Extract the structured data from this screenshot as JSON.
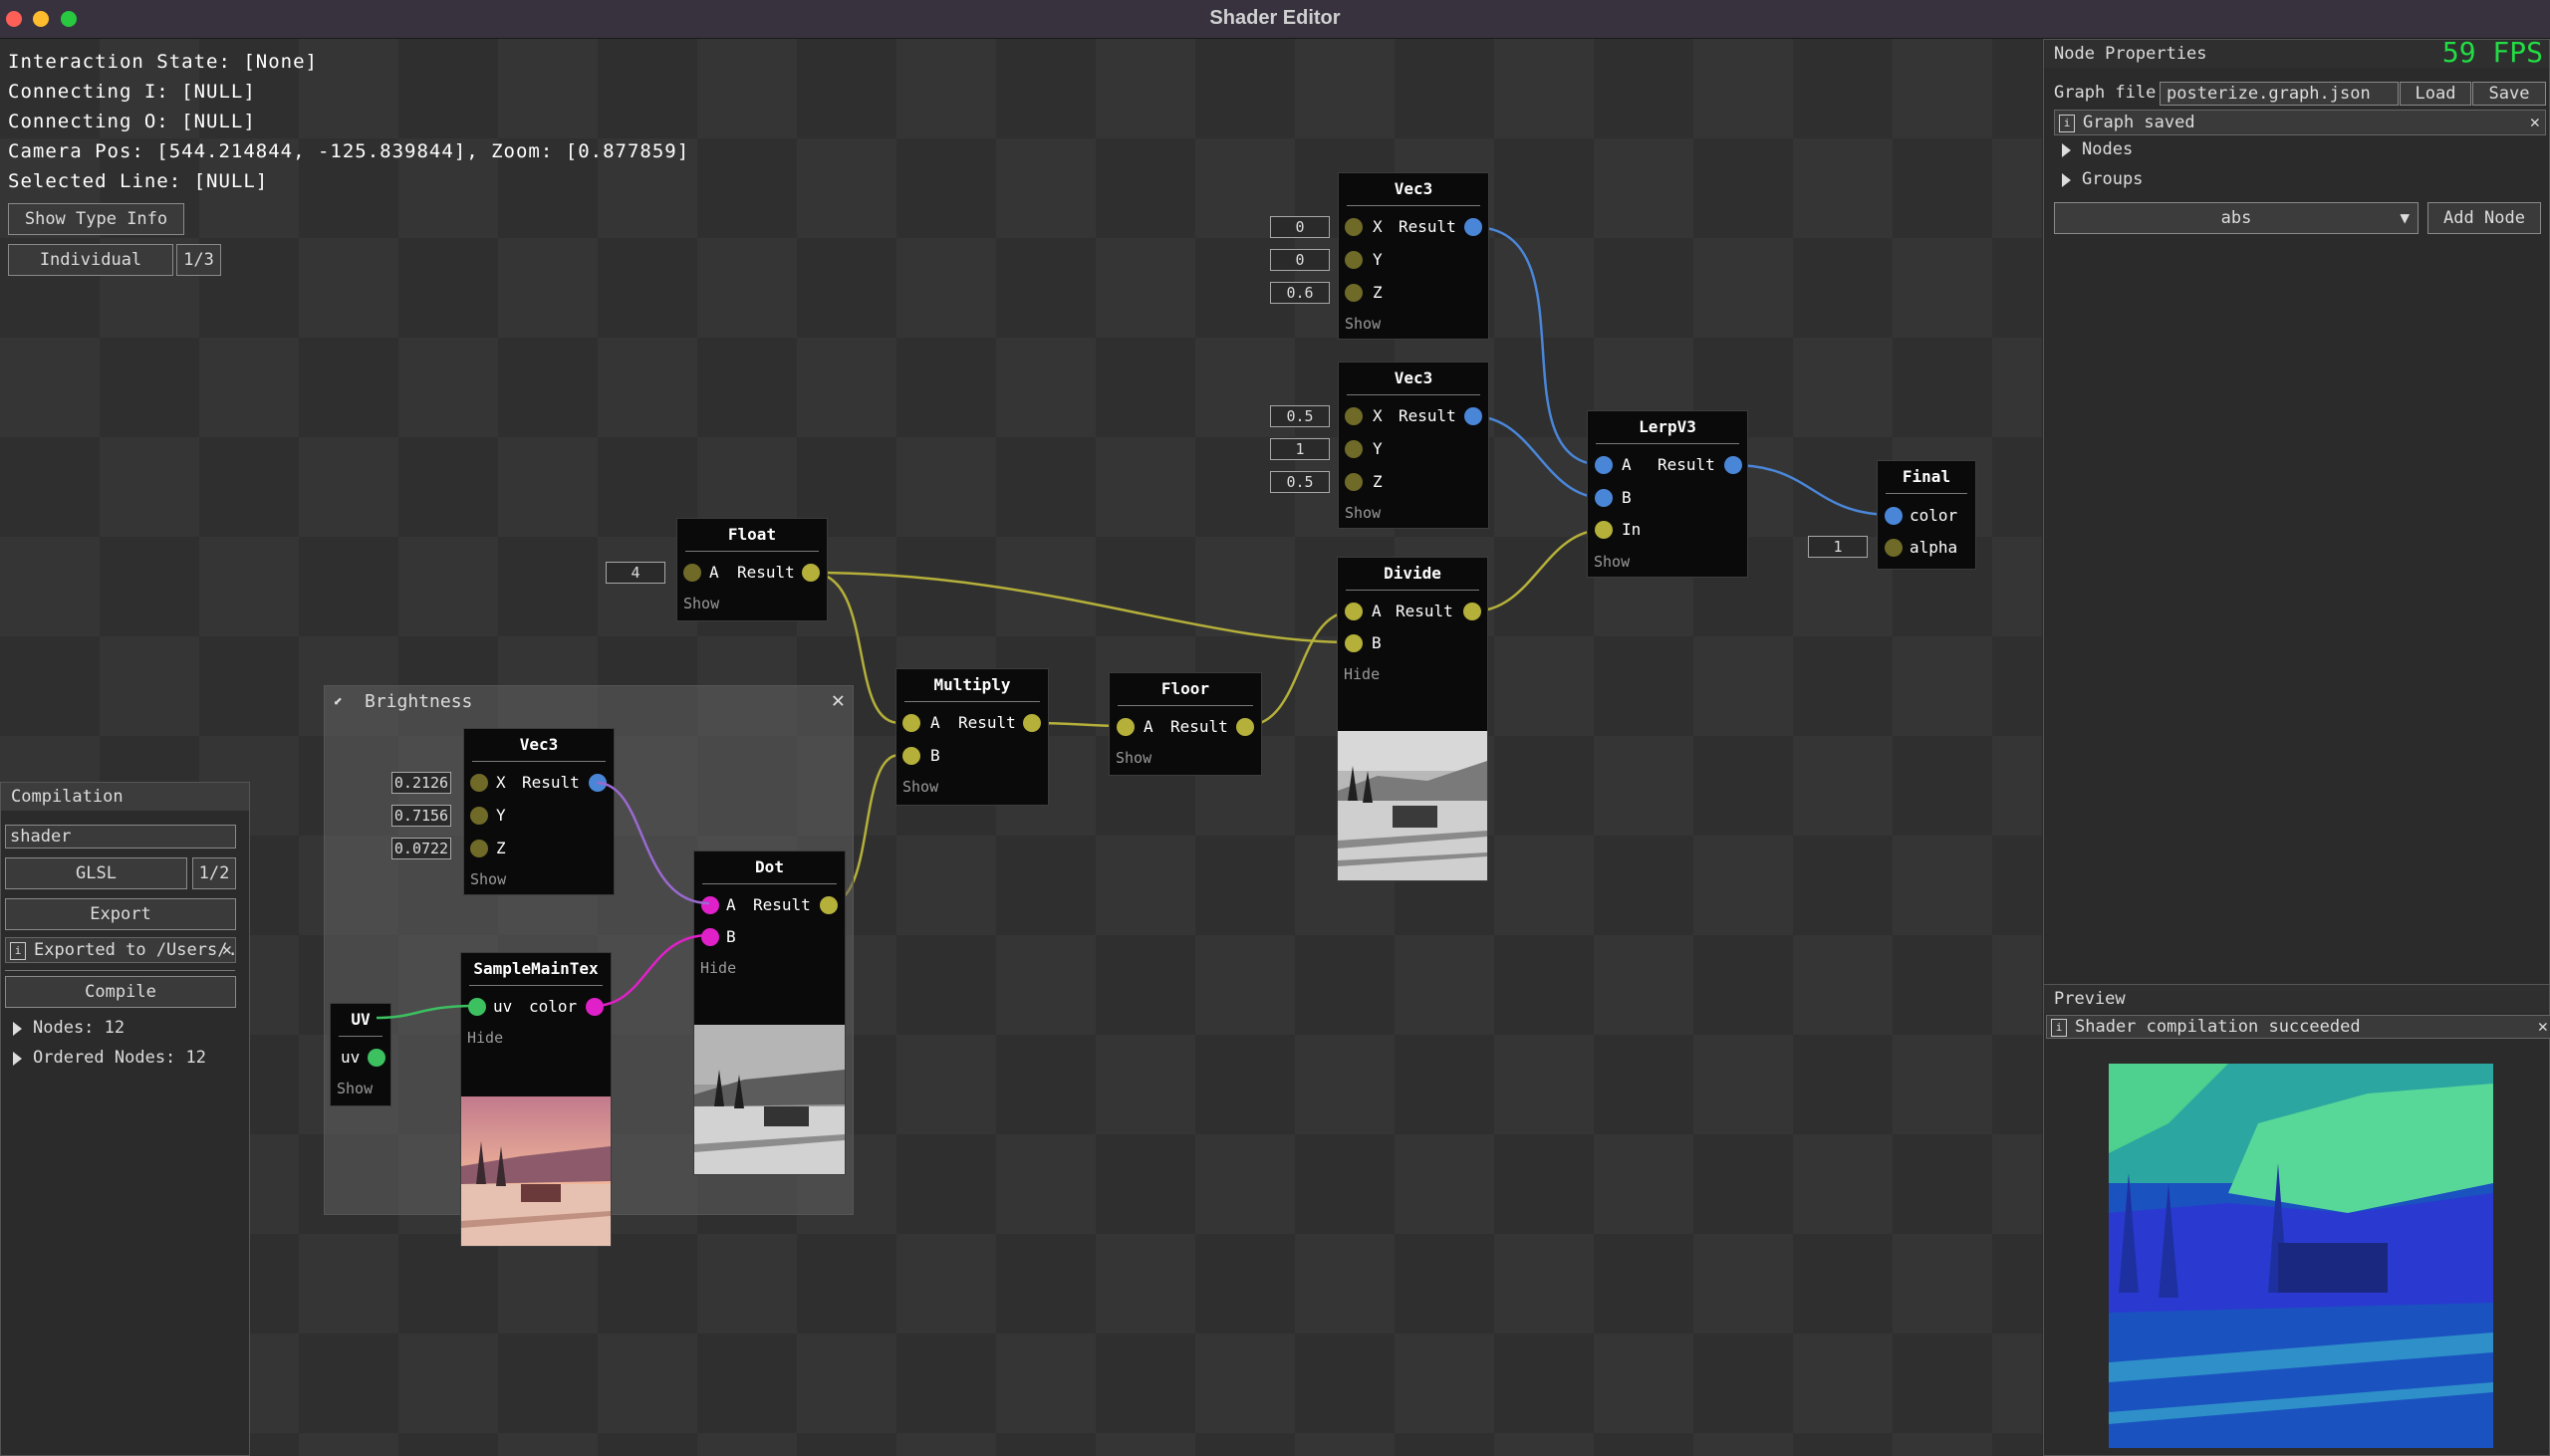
{
  "window": {
    "title": "Shader Editor"
  },
  "debug": {
    "interaction_state": "Interaction State: [None]",
    "connecting_i": "Connecting I: [NULL]",
    "connecting_o": "Connecting O: [NULL]",
    "camera": "Camera Pos: [544.214844, -125.839844], Zoom: [0.877859]",
    "selected_line": "Selected Line: [NULL]"
  },
  "toolbar": {
    "show_type_info": "Show Type Info",
    "individual": "Individual",
    "page": "1/3"
  },
  "compilation": {
    "title": "Compilation",
    "name_value": "shader",
    "language": "GLSL",
    "lang_page": "1/2",
    "export": "Export",
    "export_msg": "Exported to /Users/...",
    "compile": "Compile",
    "nodes": "Nodes: 12",
    "ordered_nodes": "Ordered Nodes: 12"
  },
  "group": {
    "title": "Brightness"
  },
  "nodes": {
    "vec3a": {
      "title": "Vec3",
      "x": "X",
      "y": "Y",
      "z": "Z",
      "out": "Result",
      "show": "Show",
      "vx": "0",
      "vy": "0",
      "vz": "0.6"
    },
    "vec3b": {
      "title": "Vec3",
      "x": "X",
      "y": "Y",
      "z": "Z",
      "out": "Result",
      "show": "Show",
      "vx": "0.5",
      "vy": "1",
      "vz": "0.5"
    },
    "lerp": {
      "title": "LerpV3",
      "a": "A",
      "b": "B",
      "in": "In",
      "out": "Result",
      "show": "Show"
    },
    "final": {
      "title": "Final",
      "color": "color",
      "alpha": "alpha",
      "v_alpha": "1"
    },
    "float": {
      "title": "Float",
      "a": "A",
      "out": "Result",
      "show": "Show",
      "va": "4"
    },
    "divide": {
      "title": "Divide",
      "a": "A",
      "b": "B",
      "out": "Result",
      "show": "Hide"
    },
    "multiply": {
      "title": "Multiply",
      "a": "A",
      "b": "B",
      "out": "Result",
      "show": "Show"
    },
    "floor": {
      "title": "Floor",
      "a": "A",
      "out": "Result",
      "show": "Show"
    },
    "vec3c": {
      "title": "Vec3",
      "x": "X",
      "y": "Y",
      "z": "Z",
      "out": "Result",
      "show": "Show",
      "vx": "0.2126",
      "vy": "0.7156",
      "vz": "0.0722"
    },
    "dot": {
      "title": "Dot",
      "a": "A",
      "b": "B",
      "out": "Result",
      "show": "Hide"
    },
    "uv": {
      "title": "UV",
      "out": "uv",
      "show": "Show"
    },
    "sample": {
      "title": "SampleMainTex",
      "in": "uv",
      "out": "color",
      "show": "Hide"
    }
  },
  "properties": {
    "title": "Node Properties",
    "fps": "59 FPS",
    "graph_file_label": "Graph file",
    "graph_file_value": "posterize.graph.json",
    "load": "Load",
    "save": "Save",
    "saved_msg": "Graph saved",
    "nodes": "Nodes",
    "groups": "Groups",
    "node_type": "abs",
    "add_node": "Add Node"
  },
  "preview": {
    "title": "Preview",
    "msg": "Shader compilation succeeded"
  },
  "colors": {
    "float_pin": "#b5b03a",
    "vec3_pin": "#4a86d8",
    "vec4_pin": "#e020c8",
    "vec2_pin": "#3cc060",
    "fps": "#22dd44"
  }
}
